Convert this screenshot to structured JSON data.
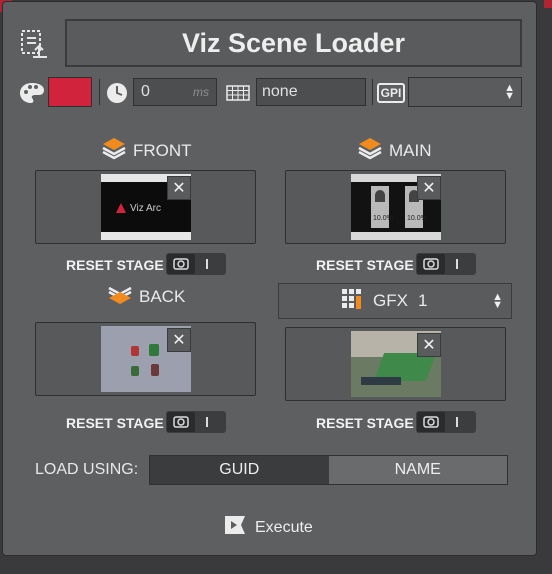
{
  "title": "Viz Scene Loader",
  "toolbar": {
    "color_swatch": "#d1243c",
    "delay_value": "0",
    "delay_unit": "ms",
    "grid_value": "none",
    "gpi_label": "GPI",
    "gpi_selected": ""
  },
  "layers": {
    "front": {
      "label": "FRONT",
      "thumb_text": "Viz Arc"
    },
    "main": {
      "label": "MAIN",
      "thumb_text": "10.0%"
    },
    "back": {
      "label": "BACK"
    },
    "gfx": {
      "label": "GFX",
      "value": "1"
    }
  },
  "reset_label": "RESET STAGE",
  "load_using": {
    "label": "LOAD USING:",
    "options": [
      "GUID",
      "NAME"
    ],
    "selected": "GUID"
  },
  "execute_label": "Execute",
  "colors": {
    "panel": "#5e5f61",
    "accent": "#f28a1d",
    "swatch": "#d1243c"
  }
}
